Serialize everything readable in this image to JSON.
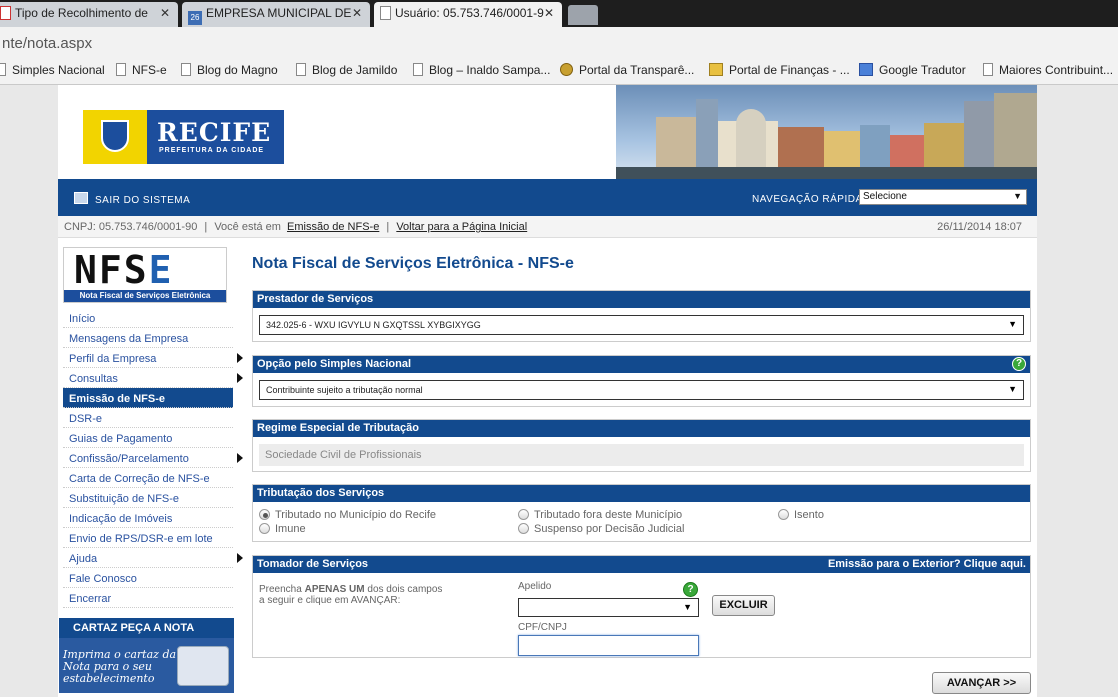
{
  "browser": {
    "tabs": [
      {
        "title": "Tipo de Recolhimento de",
        "close": "✕"
      },
      {
        "title": "EMPRESA MUNICIPAL DE",
        "close": "✕",
        "icon_text": "26"
      },
      {
        "title": "Usuário: 05.753.746/0001-9",
        "close": "✕"
      }
    ],
    "url": "nte/nota.aspx",
    "bookmarks": [
      "Simples Nacional",
      "NFS-e",
      "Blog do Magno",
      "Blog de Jamildo",
      "Blog – Inaldo Sampa...",
      "Portal da Transparê...",
      "Portal de Finanças - ...",
      "Google Tradutor",
      "Maiores Contribuint..."
    ]
  },
  "header": {
    "logo_title": "RECIFE",
    "logo_subtitle": "PREFEITURA DA CIDADE"
  },
  "navbar": {
    "exit_label": "SAIR DO SISTEMA",
    "quick_label": "NAVEGAÇÃO RÁPIDA",
    "quick_select": "Selecione",
    "arrow": "▼"
  },
  "infobar": {
    "cnpj": "CNPJ: 05.753.746/0001-90",
    "sep": "|",
    "location_prefix": "Você está em",
    "current_page": "Emissão de NFS-e",
    "back_link": "Voltar para a Página Inicial",
    "datetime": "26/11/2014 18:07"
  },
  "sidebar": {
    "logo_big": "NFS",
    "logo_e": "E",
    "logo_strip": "Nota Fiscal de Serviços Eletrônica",
    "items": [
      {
        "label": "Início"
      },
      {
        "label": "Mensagens da Empresa"
      },
      {
        "label": "Perfil da Empresa"
      },
      {
        "label": "Consultas"
      },
      {
        "label": "Emissão de NFS-e"
      },
      {
        "label": "DSR-e"
      },
      {
        "label": "Guias de Pagamento"
      },
      {
        "label": "Confissão/Parcelamento"
      },
      {
        "label": "Carta de Correção de NFS-e"
      },
      {
        "label": "Substituição de NFS-e"
      },
      {
        "label": "Indicação de Imóveis"
      },
      {
        "label": "Envio de RPS/DSR-e em lote"
      },
      {
        "label": "Ajuda"
      },
      {
        "label": "Fale Conosco"
      },
      {
        "label": "Encerrar"
      }
    ],
    "cartaz_title": "CARTAZ PEÇA A NOTA",
    "cartaz_text": "Imprima o cartaz da Nota para o seu estabelecimento"
  },
  "main": {
    "title": "Nota Fiscal de Serviços Eletrônica - NFS-e",
    "prestador": {
      "heading": "Prestador de Serviços",
      "value": "342.025-6 - WXU IGVYLU N GXQTSSL XYBGIXYGG"
    },
    "simples": {
      "heading": "Opção pelo Simples Nacional",
      "value": "Contribuinte sujeito a tributação normal",
      "help": "?"
    },
    "regime": {
      "heading": "Regime Especial de Tributação",
      "value": "Sociedade Civil de Profissionais"
    },
    "tributacao": {
      "heading": "Tributação dos Serviços",
      "options": [
        "Tributado no Município do Recife",
        "Tributado fora deste Município",
        "Isento",
        "Imune",
        "Suspenso por Decisão Judicial"
      ]
    },
    "tomador": {
      "heading": "Tomador de Serviços",
      "exterior_link": "Emissão para o Exterior? Clique aqui.",
      "instr_pre": "Preencha",
      "instr_bold": "APENAS UM",
      "instr_post": "dos dois campos",
      "instr_line2": "a seguir e clique em AVANÇAR:",
      "apelido_label": "Apelido",
      "cpf_label": "CPF/CNPJ",
      "excluir": "EXCLUIR",
      "help": "?"
    },
    "avancar": "AVANÇAR >>"
  }
}
